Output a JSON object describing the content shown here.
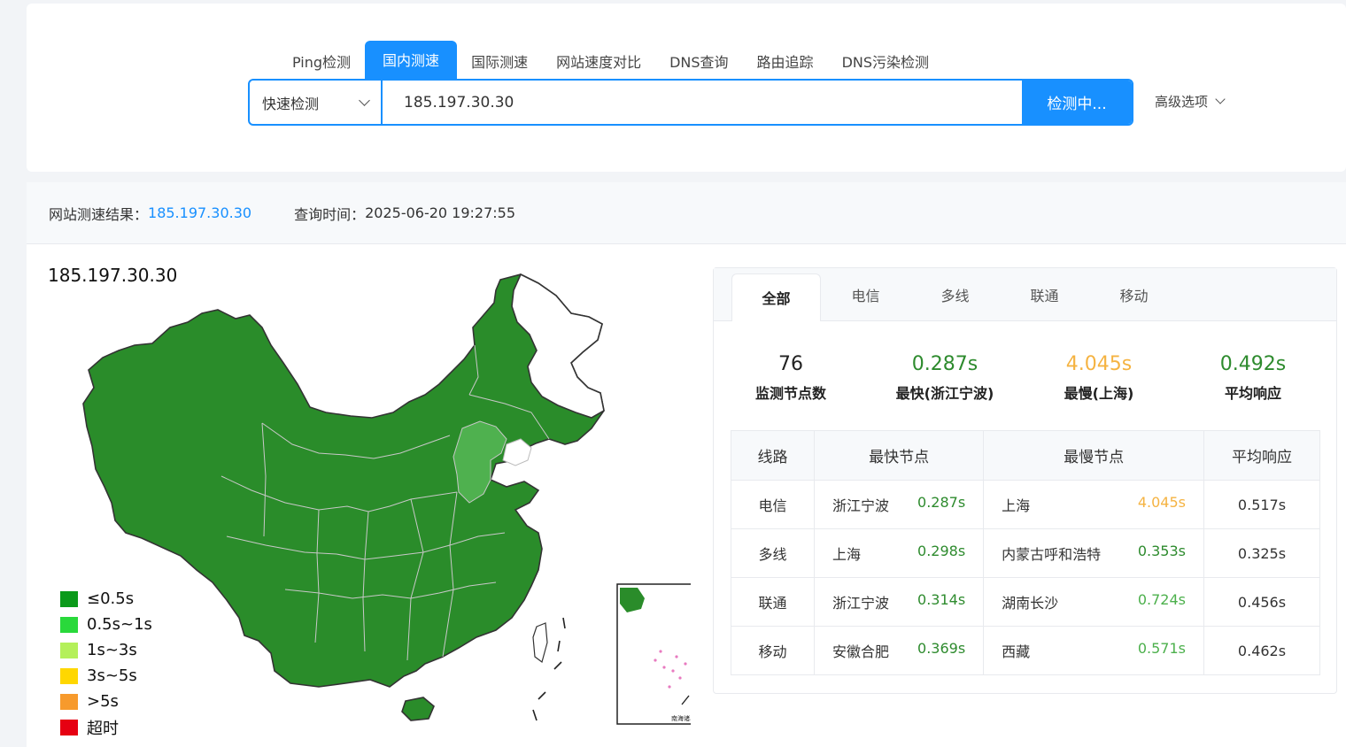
{
  "nav": {
    "tabs": [
      {
        "label": "Ping检测",
        "active": false
      },
      {
        "label": "国内测速",
        "active": true
      },
      {
        "label": "国际测速",
        "active": false
      },
      {
        "label": "网站速度对比",
        "active": false
      },
      {
        "label": "DNS查询",
        "active": false
      },
      {
        "label": "路由追踪",
        "active": false
      },
      {
        "label": "DNS污染检测",
        "active": false
      }
    ]
  },
  "search": {
    "mode": "快速检测",
    "host": "185.197.30.30",
    "button": "检测中...",
    "advanced": "高级选项"
  },
  "result": {
    "label": "网站测速结果：",
    "host": "185.197.30.30",
    "time_label": "查询时间：",
    "time": "2025-06-20 19:27:55"
  },
  "map": {
    "title": "185.197.30.30",
    "inset_label": "南海诸岛",
    "legend": [
      {
        "label": "≤0.5s",
        "color": "#0a9a1a"
      },
      {
        "label": "0.5s~1s",
        "color": "#29d93b"
      },
      {
        "label": "1s~3s",
        "color": "#b4f05a"
      },
      {
        "label": "3s~5s",
        "color": "#ffd700"
      },
      {
        "label": ">5s",
        "color": "#f79a2c"
      },
      {
        "label": "超时",
        "color": "#e60012"
      }
    ],
    "fill_main": "#2a8c2a",
    "fill_light": "#4fb14f"
  },
  "stats": {
    "tabs": [
      "全部",
      "电信",
      "多线",
      "联通",
      "移动"
    ],
    "active_tab": "全部",
    "summary": [
      {
        "value": "76",
        "label": "监测节点数",
        "color": "#222"
      },
      {
        "value": "0.287s",
        "label": "最快(浙江宁波)",
        "color": "#2e8b2e"
      },
      {
        "value": "4.045s",
        "label": "最慢(上海)",
        "color": "#f5b342"
      },
      {
        "value": "0.492s",
        "label": "平均响应",
        "color": "#2e8b2e"
      }
    ],
    "table_headers": [
      "线路",
      "最快节点",
      "最慢节点",
      "平均响应"
    ],
    "rows": [
      {
        "line": "电信",
        "fast_node": "浙江宁波",
        "fast_time": "0.287s",
        "slow_node": "上海",
        "slow_time": "4.045s",
        "avg": "0.517s"
      },
      {
        "line": "多线",
        "fast_node": "上海",
        "fast_time": "0.298s",
        "slow_node": "内蒙古呼和浩特",
        "slow_time": "0.353s",
        "avg": "0.325s"
      },
      {
        "line": "联通",
        "fast_node": "浙江宁波",
        "fast_time": "0.314s",
        "slow_node": "湖南长沙",
        "slow_time": "0.724s",
        "avg": "0.456s"
      },
      {
        "line": "移动",
        "fast_node": "安徽合肥",
        "fast_time": "0.369s",
        "slow_node": "西藏",
        "slow_time": "0.571s",
        "avg": "0.462s"
      }
    ]
  }
}
